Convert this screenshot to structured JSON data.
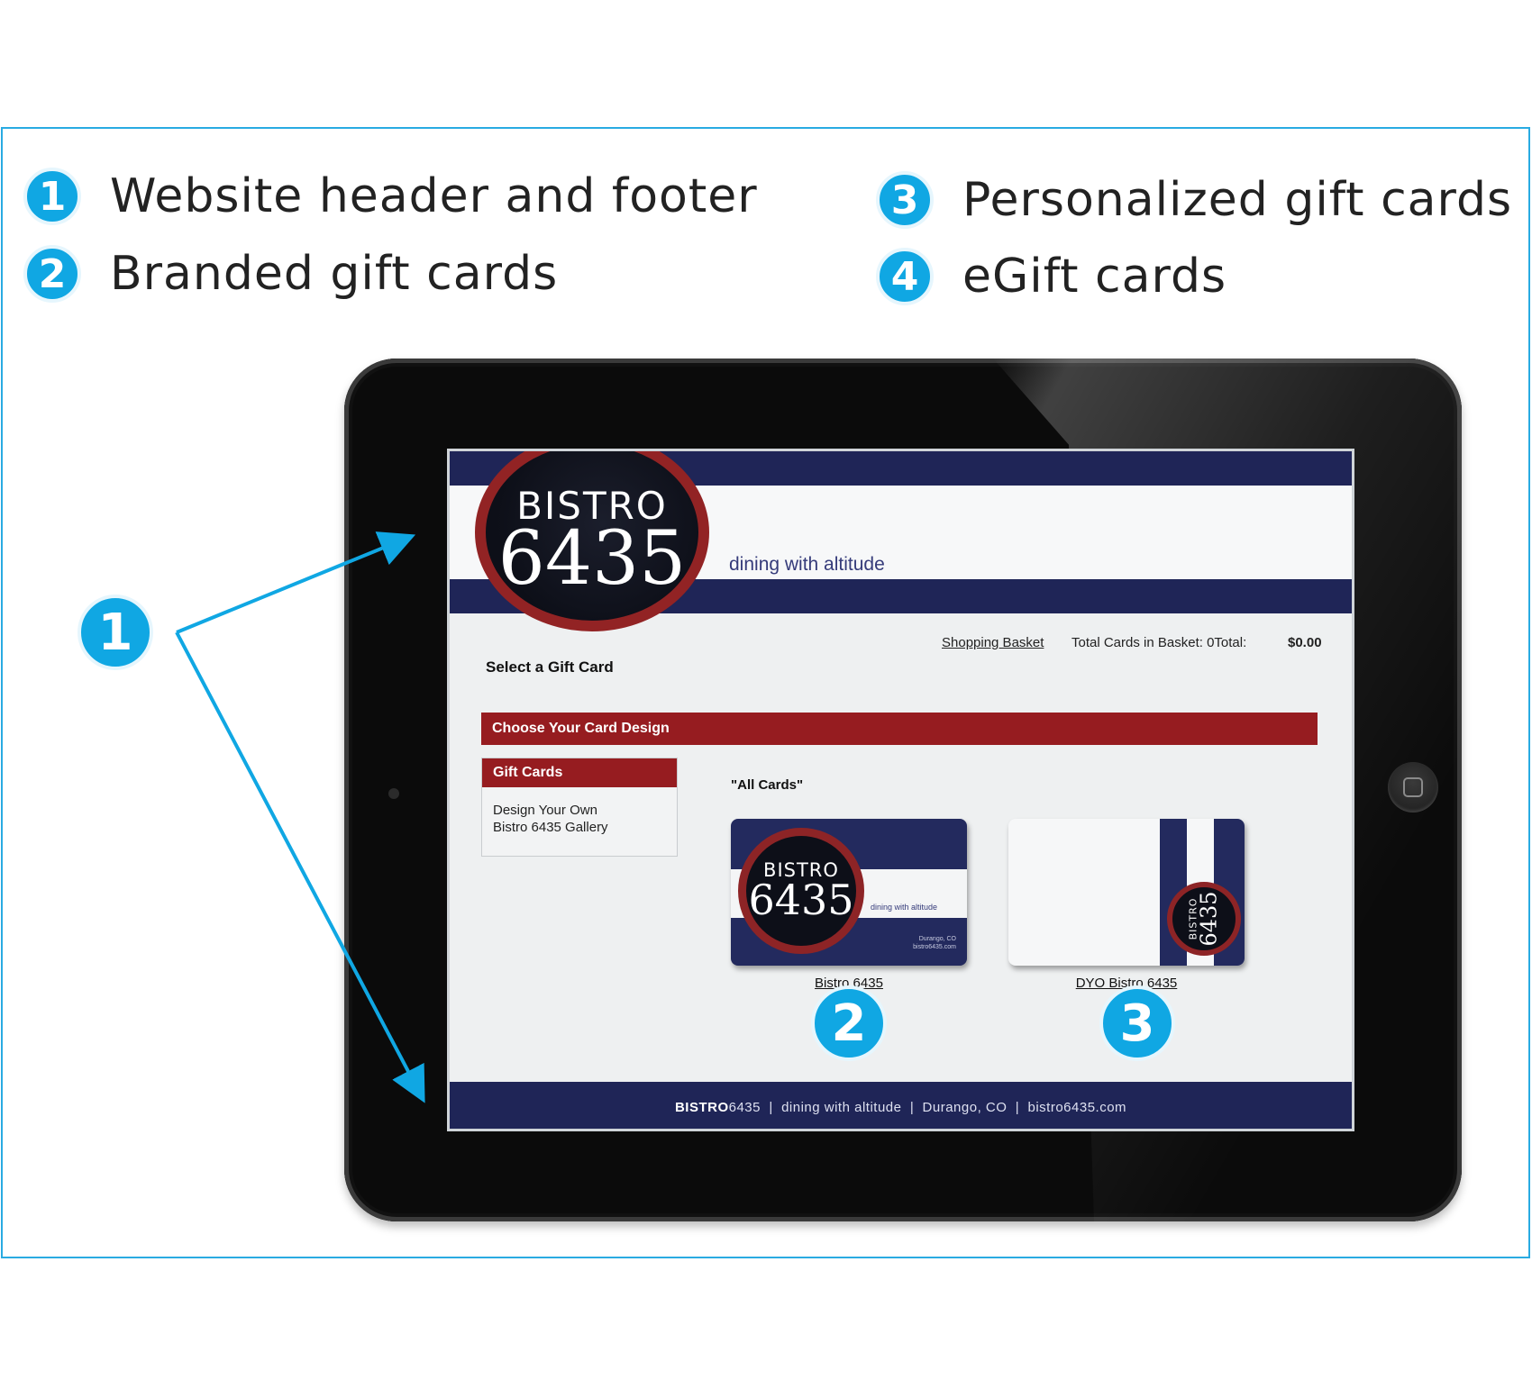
{
  "legend": [
    {
      "num": "1",
      "text": "Website header and footer"
    },
    {
      "num": "2",
      "text": "Branded gift cards"
    },
    {
      "num": "3",
      "text": "Personalized gift cards"
    },
    {
      "num": "4",
      "text": "eGift cards"
    }
  ],
  "callouts": {
    "header_footer": "1",
    "branded": "2",
    "personalized": "3"
  },
  "site": {
    "logo_line1": "BISTRO",
    "logo_line2": "6435",
    "tagline": "dining with altitude",
    "basket_link": "Shopping Basket",
    "basket_count": "Total Cards in Basket: 0Total:",
    "basket_total": "$0.00",
    "select_title": "Select a Gift Card",
    "choose_bar": "Choose Your Card Design",
    "sidebar": {
      "header": "Gift Cards",
      "items": [
        "Design Your Own",
        "Bistro 6435 Gallery"
      ]
    },
    "all_cards_label": "\"All Cards\"",
    "cards": [
      {
        "label": "Bistro 6435",
        "logo_line1": "BISTRO",
        "logo_line2": "6435",
        "tagline": "dining with altitude",
        "address1": "Durango, CO",
        "address2": "bistro6435.com"
      },
      {
        "label": "DYO Bistro 6435",
        "logo_line1": "BISTRO",
        "logo_line2": "6435"
      }
    ],
    "footer": {
      "brand_bold": "BISTRO",
      "brand_rest": "6435",
      "rest": "  |  dining with altitude  |  Durango, CO  |  bistro6435.com"
    }
  },
  "colors": {
    "accent_blue": "#10a7e3",
    "navy": "#1f2557",
    "brand_red": "#961c20"
  }
}
